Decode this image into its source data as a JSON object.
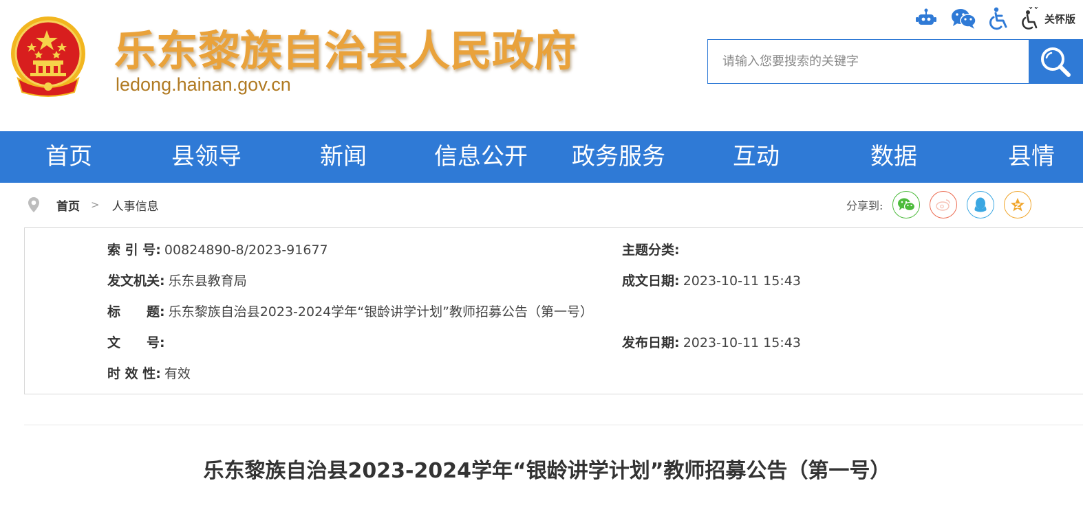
{
  "header": {
    "site_title": "乐东黎族自治县人民政府",
    "site_domain": "ledong.hainan.gov.cn",
    "care_mode_label": "关怀版",
    "search": {
      "placeholder": "请输入您要搜索的关键字",
      "value": ""
    },
    "tool_icons": [
      "robot-icon",
      "wechat-icon",
      "accessibility-icon",
      "elder-care-icon"
    ],
    "colors": {
      "title": "#e9a23b",
      "domain": "#b07a22",
      "accent": "#2f7ad6"
    }
  },
  "nav": {
    "items": [
      "首页",
      "县领导",
      "新闻",
      "信息公开",
      "政务服务",
      "互动",
      "数据",
      "县情"
    ]
  },
  "breadcrumb": {
    "home": "首页",
    "separator": ">",
    "current": "人事信息"
  },
  "share": {
    "label": "分享到:",
    "targets": [
      {
        "icon": "wechat-share-icon",
        "color": "#4dbb3c"
      },
      {
        "icon": "weibo-share-icon",
        "color": "#ec6a50"
      },
      {
        "icon": "qq-share-icon",
        "color": "#3aa7e2"
      },
      {
        "icon": "qzone-share-icon",
        "color": "#f0a52a"
      }
    ]
  },
  "info": {
    "index_label": "索 引 号:",
    "index_value": "00824890-8/2023-91677",
    "topic_label": "主题分类:",
    "topic_value": "",
    "issuer_label": "发文机关:",
    "issuer_value": "乐东县教育局",
    "created_label": "成文日期:",
    "created_value": "2023-10-11 15:43",
    "title_label": "标　　题:",
    "title_value": "乐东黎族自治县2023-2024学年“银龄讲学计划”教师招募公告（第一号）",
    "docno_label": "文　　号:",
    "docno_value": "",
    "published_label": "发布日期:",
    "published_value": "2023-10-11 15:43",
    "validity_label": "时 效 性:",
    "validity_value": "有效"
  },
  "article": {
    "title": "乐东黎族自治县2023-2024学年“银龄讲学计划”教师招募公告（第一号）"
  }
}
